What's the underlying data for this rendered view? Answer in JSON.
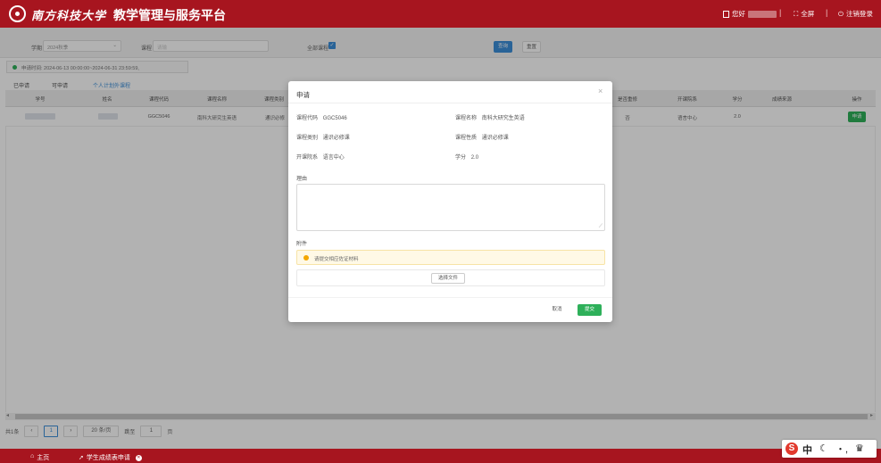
{
  "header": {
    "university_name": "南方科技大学",
    "platform_title": "教学管理与服务平台",
    "user_greeting": "您好",
    "fullscreen_label": "全屏",
    "logout_label": "注销登录"
  },
  "filters": {
    "semester_label": "学期",
    "semester_value": "2024秋季",
    "course_label": "课程",
    "course_placeholder": "请输",
    "all_courses_label": "全部课程",
    "search_button": "查询",
    "reset_button": "重置"
  },
  "notice": {
    "text": "申请时间: 2024-06-13 00:00:00~2024-06-31 23:59:59,"
  },
  "tabs": [
    "已申请",
    "可申请",
    "个人计划外课程"
  ],
  "table": {
    "headers": [
      "学号",
      "姓名",
      "课程代码",
      "课程名称",
      "课程类别",
      "是否重修",
      "开课院系",
      "学分",
      "成绩来源",
      "操作"
    ],
    "rows": [
      {
        "course_code": "GGC5046",
        "course_name": "南科大研究生英语",
        "course_type": "通识必修",
        "retake": "否",
        "department": "语言中心",
        "credits": "2.0",
        "action": "申请"
      }
    ]
  },
  "pagination": {
    "total": "共1条",
    "page": "1",
    "page_size": "20 条/页",
    "goto_label": "跳至",
    "goto_value": "1",
    "page_suffix": "页"
  },
  "bottom_tabs": {
    "home": "主页",
    "current": "学生成绩表申请"
  },
  "dialog": {
    "title": "申请",
    "course_code_label": "课程代码",
    "course_code": "GGC5046",
    "course_name_label": "课程名称",
    "course_name": "南科大研究生英语",
    "course_type_label": "课程类别",
    "course_type": "通识必修课",
    "course_nature_label": "课程性质",
    "course_nature": "通识必修课",
    "department_label": "开课院系",
    "department": "语言中心",
    "credits_label": "学分",
    "credits": "2.0",
    "reason_label": "理由",
    "attachment_label": "附件",
    "attachment_warning": "请提交相应佐证材料",
    "choose_file": "选择文件",
    "cancel_button": "取消",
    "submit_button": "提交"
  },
  "ime": {
    "glyphs": "中",
    "extra": "・,"
  },
  "colors": {
    "brand_red": "#a7151f",
    "primary_blue": "#3b8ed8",
    "success_green": "#2eb05a",
    "warning_orange": "#f4a700"
  }
}
